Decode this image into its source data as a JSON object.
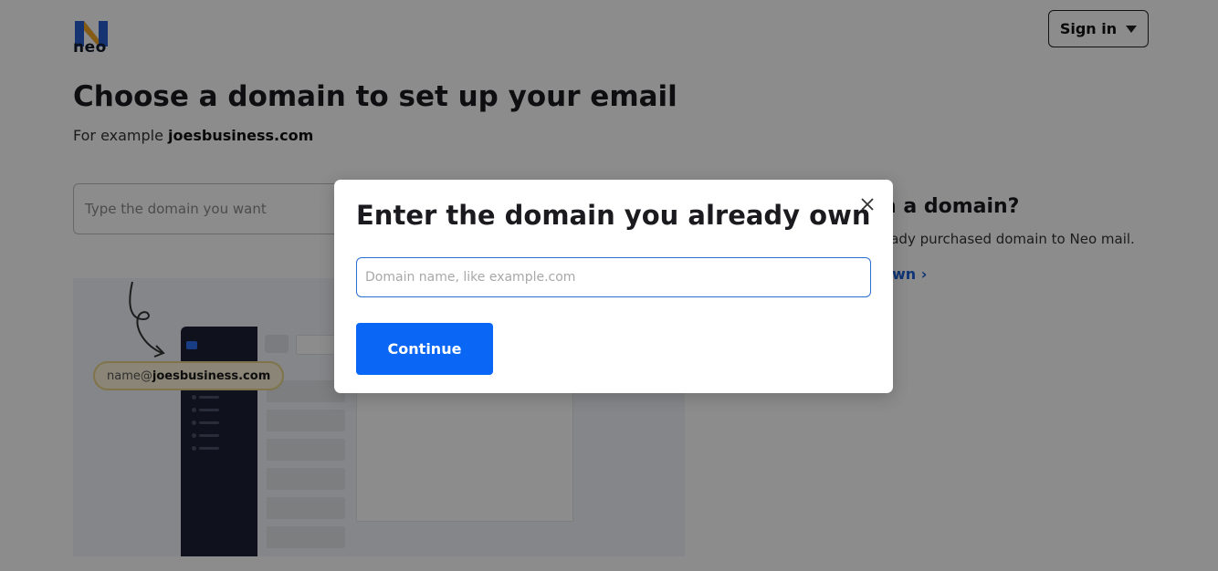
{
  "header": {
    "logo_text": "neo",
    "signin_label": "Sign in"
  },
  "main": {
    "title": "Choose a domain to set up your email",
    "subtitle_prefix": "For example ",
    "subtitle_example": "joesbusiness.com",
    "search_placeholder": "Type the domain you want"
  },
  "side": {
    "heading": "n a domain?",
    "text": "eady purchased domain to Neo mail.",
    "link": "own ›"
  },
  "illustration": {
    "pill_prefix": "name@",
    "pill_domain": "joesbusiness.com"
  },
  "modal": {
    "title": "Enter the domain you already own",
    "input_placeholder": "Domain name, like example.com",
    "input_value": "",
    "continue_label": "Continue"
  },
  "colors": {
    "accent": "#0a66f5",
    "link": "#1c5fd6",
    "input_border": "#2a6fd1"
  }
}
